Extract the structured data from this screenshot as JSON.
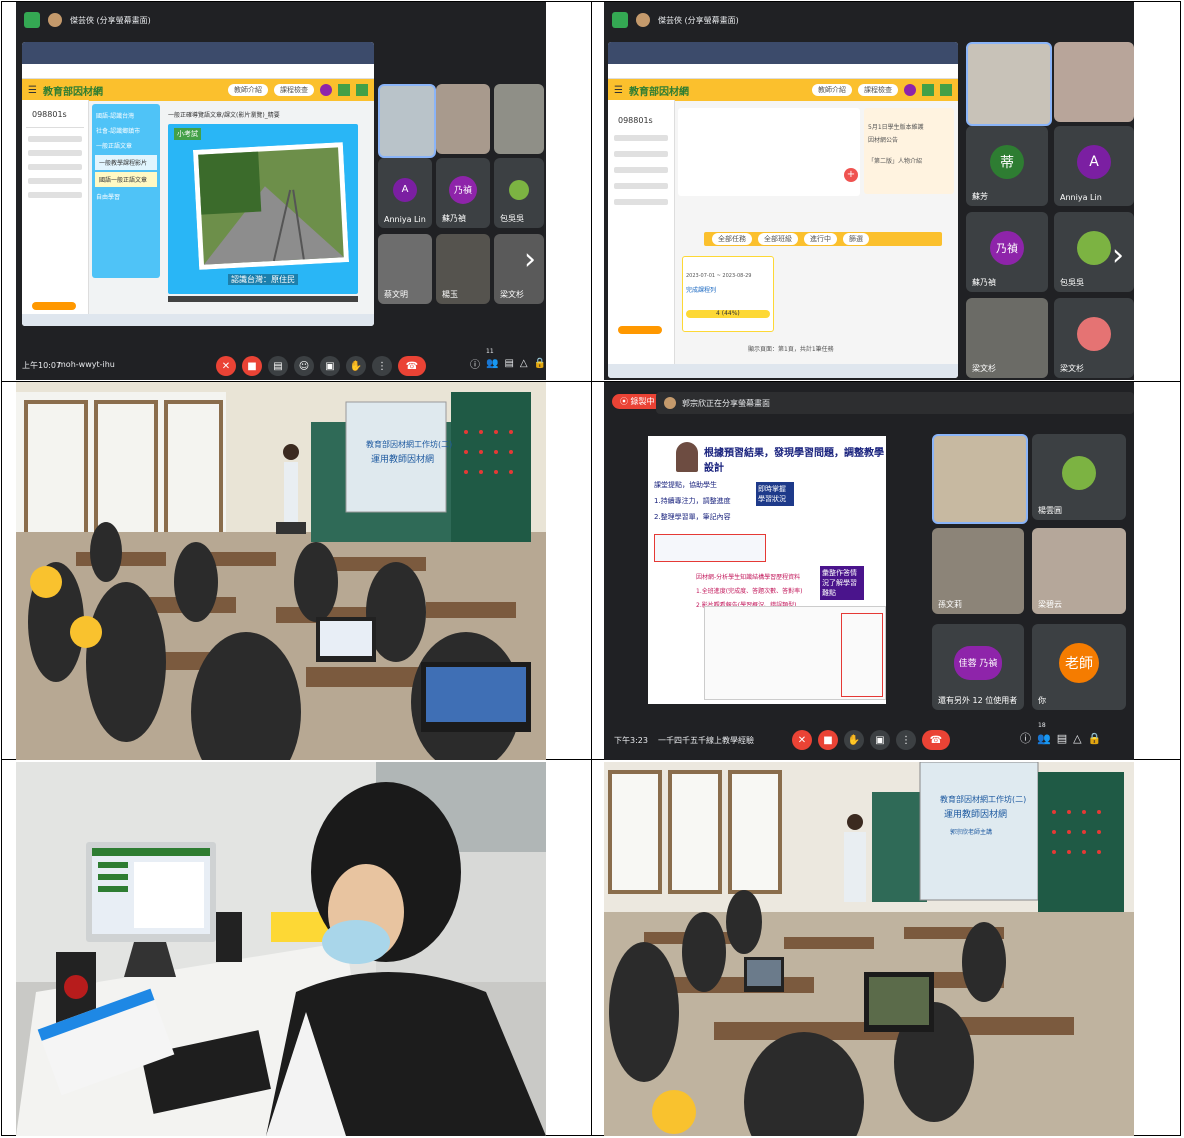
{
  "panel1": {
    "meeting_title": "傑芸俠 (分享螢幕畫面)",
    "site_title": "教育部因材網",
    "toolbar_buttons": [
      "教師介紹",
      "課程檢查"
    ],
    "sidebar_code": "098801s",
    "lesson_items": [
      "國語-認識台灣",
      "社會-認識鄉鎮市",
      "一般正語文章",
      "一般教學課程影片",
      "國語一般正語文章",
      "自由學習"
    ],
    "breadcrumb": "一般正確導覽語文章/課文(影片瀏覽)_精要",
    "lesson_badge": "小考試",
    "video_caption": "認識台灣：原住民",
    "time": "上午10:07",
    "meeting_code": "moh-wwyt-ihu",
    "participants": [
      {
        "name": "",
        "type": "video"
      },
      {
        "name": "",
        "type": "video"
      },
      {
        "name": "",
        "type": "video"
      },
      {
        "name": "Anniya Lin",
        "type": "avatar",
        "letter": "A",
        "color": "#7b1fa2"
      },
      {
        "name": "蘇乃禎",
        "type": "avatar",
        "letter": "乃禎",
        "color": "#8e24aa"
      },
      {
        "name": "包吳吳",
        "type": "video"
      },
      {
        "name": "蔡文明",
        "type": "video"
      },
      {
        "name": "楊玉",
        "type": "video"
      },
      {
        "name": "梁文杉",
        "type": "video"
      }
    ],
    "participant_count": "11"
  },
  "panel2": {
    "meeting_title": "傑芸俠 (分享螢幕畫面)",
    "site_title": "教育部因材網",
    "toolbar_buttons": [
      "教師介紹",
      "課程檢查"
    ],
    "sidebar_code": "098801s",
    "filters": [
      "全部任務",
      "全部班級",
      "進行中",
      "篩選"
    ],
    "task_dates": "2023-07-01 ~ 2023-08-29",
    "task_link": "完成課程列",
    "progress_text": "4 (44%)",
    "footer_text": "顯示頁面：第1頁，共計1筆任務",
    "notice_lines": [
      "5月1日學生版本維護",
      "因材網公告",
      "「第二版」人物介紹"
    ],
    "participants": [
      {
        "name": "",
        "type": "video"
      },
      {
        "name": "",
        "type": "video"
      },
      {
        "name": "蘇芳",
        "type": "avatar",
        "letter": "蒂",
        "color": "#2e7d32"
      },
      {
        "name": "Anniya Lin",
        "type": "avatar",
        "letter": "A",
        "color": "#7b1fa2"
      },
      {
        "name": "蘇乃禎",
        "type": "avatar",
        "letter": "乃禎",
        "color": "#8e24aa"
      },
      {
        "name": "包吳吳",
        "type": "video"
      },
      {
        "name": "梁文杉",
        "type": "video"
      },
      {
        "name": "梁文杉",
        "type": "video"
      }
    ]
  },
  "panel3": {
    "board_line1": "教育部因材網工作坊(二)",
    "board_line2": "運用教師因材網"
  },
  "panel4": {
    "recording_label": "錄製中",
    "meeting_title": "郭宗欣正在分享螢幕畫面",
    "slide_title": "根據預習結果，發現學習問題，調整教學設計",
    "slide_box1_lines": [
      "課堂提點，協助學生",
      "1.持續專注力，調整進度",
      "2.整理學習單，筆記內容"
    ],
    "slide_tag1": "即時掌握學習狀況",
    "slide_box2_lines": [
      "因材網-分析學生知識結構學習歷程資料",
      "1.全班進度(完成度、答題次數、答對率)",
      "2.影片觀看報告(學習概況、錯誤類型)"
    ],
    "slide_tag2": "彙整作答情況了解學習難點",
    "participants": [
      {
        "name": "",
        "type": "video"
      },
      {
        "name": "楊雲圓",
        "type": "video"
      },
      {
        "name": "孫文莉",
        "type": "video"
      },
      {
        "name": "梁碧云",
        "type": "video"
      },
      {
        "name": "還有另外 12 位使用者",
        "type": "avatar",
        "letter": "佳蓉 乃禎",
        "color": "#8e24aa"
      },
      {
        "name": "你",
        "type": "avatar",
        "letter": "老師",
        "color": "#f57c00"
      }
    ],
    "time": "下午3:23",
    "meeting_code": "一千四千五千線上教學經驗",
    "participant_count": "18"
  },
  "panel5": {},
  "panel6": {
    "board_line1": "教育部因材網工作坊(二)",
    "board_line2": "運用教師因材網",
    "board_line3": "郭宗欣老師主講"
  }
}
